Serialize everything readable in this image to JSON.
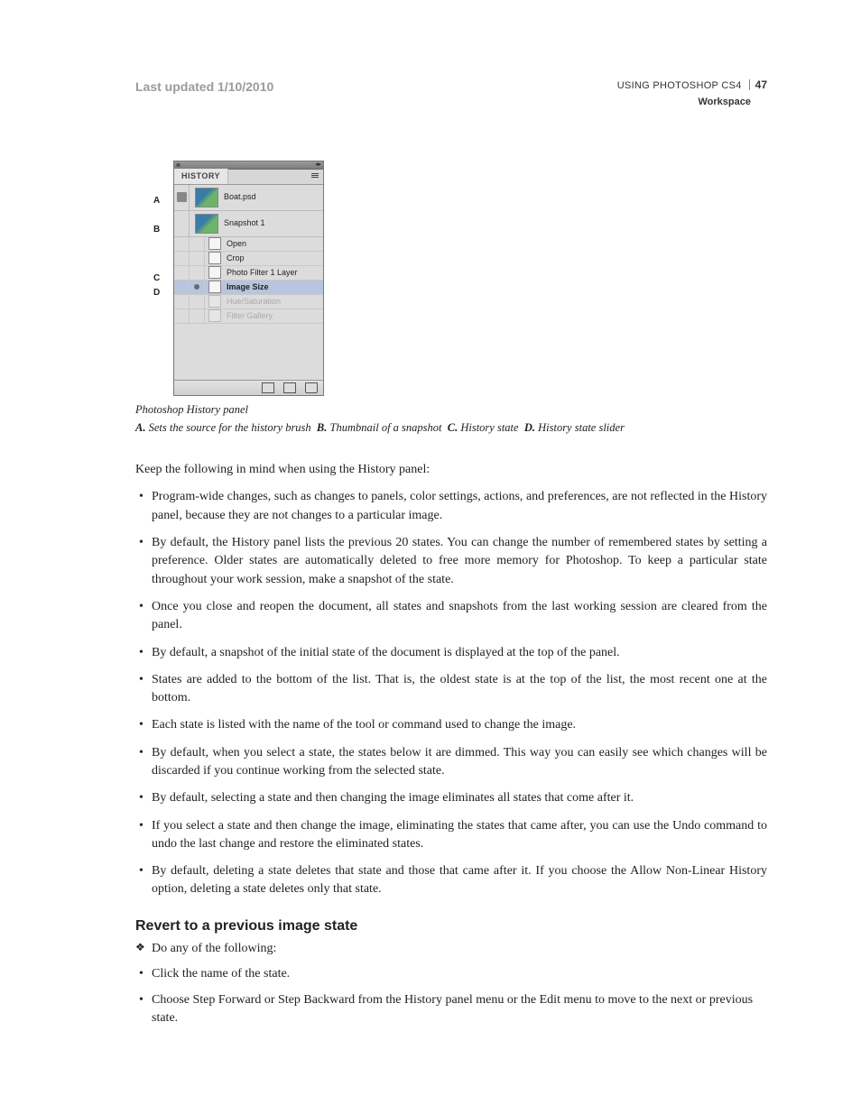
{
  "header": {
    "last_updated": "Last updated 1/10/2010",
    "doc_title": "USING PHOTOSHOP CS4",
    "page_number": "47",
    "section": "Workspace"
  },
  "figure": {
    "callout_a": "A",
    "callout_b": "B",
    "callout_c": "C",
    "callout_d": "D",
    "panel_tab": "HISTORY",
    "snapshot_1": "Boat.psd",
    "snapshot_2": "Snapshot 1",
    "states": [
      {
        "label": "Open"
      },
      {
        "label": "Crop"
      },
      {
        "label": "Photo Filter 1 Layer"
      },
      {
        "label": "Image Size"
      },
      {
        "label": "Hue/Saturation"
      },
      {
        "label": "Filter Gallery"
      }
    ]
  },
  "captions": {
    "title": "Photoshop History panel",
    "keyA_lbl": "A.",
    "keyA_desc": "Sets the source for the history brush",
    "keyB_lbl": "B.",
    "keyB_desc": "Thumbnail of a snapshot",
    "keyC_lbl": "C.",
    "keyC_desc": "History state",
    "keyD_lbl": "D.",
    "keyD_desc": "History state slider"
  },
  "intro": "Keep the following in mind when using the History panel:",
  "bullets": [
    "Program-wide changes, such as changes to panels, color settings, actions, and preferences, are not reflected in the History panel, because they are not changes to a particular image.",
    "By default, the History panel lists the previous 20 states. You can change the number of remembered states by setting a preference. Older states are automatically deleted to free more memory for Photoshop. To keep a particular state throughout your work session, make a snapshot of the state.",
    "Once you close and reopen the document, all states and snapshots from the last working session are cleared from the panel.",
    "By default, a snapshot of the initial state of the document is displayed at the top of the panel.",
    "States are added to the bottom of the list. That is, the oldest state is at the top of the list, the most recent one at the bottom.",
    "Each state is listed with the name of the tool or command used to change the image.",
    "By default, when you select a state, the states below it are dimmed. This way you can easily see which changes will be discarded if you continue working from the selected state.",
    "By default, selecting a state and then changing the image eliminates all states that come after it.",
    "If you select a state and then change the image, eliminating the states that came after, you can use the Undo command to undo the last change and restore the eliminated states.",
    "By default, deleting a state deletes that state and those that came after it. If you choose the Allow Non-Linear History option, deleting a state deletes only that state."
  ],
  "section2": {
    "heading": "Revert to a previous image state",
    "intro": "Do any of the following:",
    "items": [
      "Click the name of the state.",
      "Choose Step Forward or Step Backward from the History panel menu or the Edit menu to move to the next or previous state."
    ]
  }
}
